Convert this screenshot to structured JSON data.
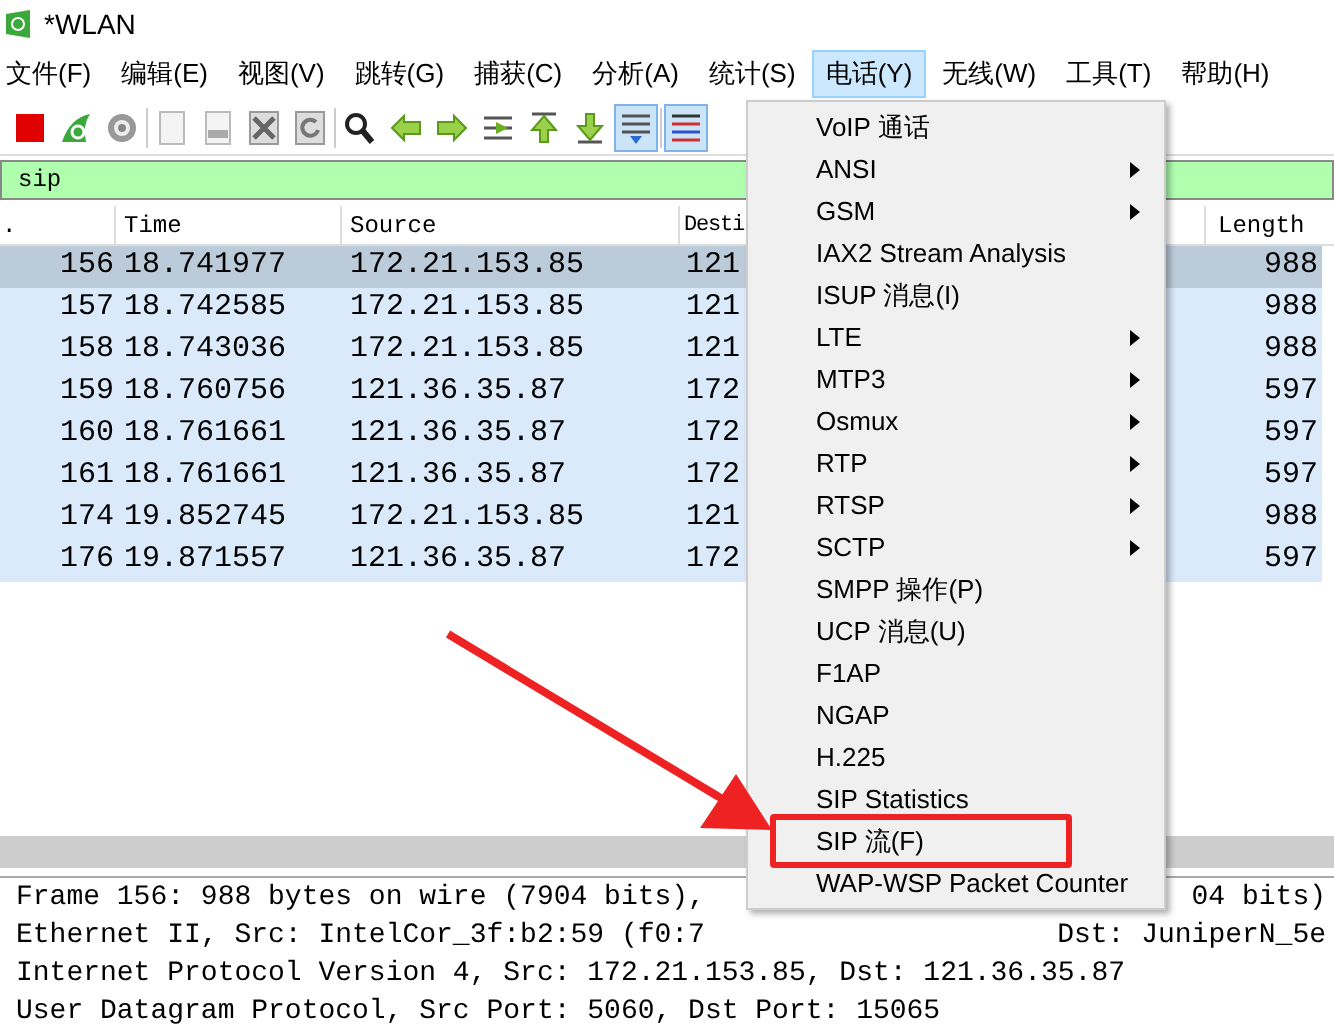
{
  "window": {
    "title": "*WLAN"
  },
  "menubar": [
    {
      "label": "文件(F)",
      "selected": false
    },
    {
      "label": "编辑(E)",
      "selected": false
    },
    {
      "label": "视图(V)",
      "selected": false
    },
    {
      "label": "跳转(G)",
      "selected": false
    },
    {
      "label": "捕获(C)",
      "selected": false
    },
    {
      "label": "分析(A)",
      "selected": false
    },
    {
      "label": "统计(S)",
      "selected": false
    },
    {
      "label": "电话(Y)",
      "selected": true
    },
    {
      "label": "无线(W)",
      "selected": false
    },
    {
      "label": "工具(T)",
      "selected": false
    },
    {
      "label": "帮助(H)",
      "selected": false
    }
  ],
  "toolbar": [
    {
      "kind": "stop",
      "selected": false
    },
    {
      "kind": "restart",
      "selected": false
    },
    {
      "kind": "options",
      "selected": false
    },
    {
      "kind": "sep"
    },
    {
      "kind": "open",
      "selected": false
    },
    {
      "kind": "save",
      "selected": false
    },
    {
      "kind": "close",
      "selected": false
    },
    {
      "kind": "reload",
      "selected": false
    },
    {
      "kind": "sep"
    },
    {
      "kind": "find",
      "selected": false
    },
    {
      "kind": "back",
      "selected": false
    },
    {
      "kind": "forward",
      "selected": false
    },
    {
      "kind": "goto",
      "selected": false
    },
    {
      "kind": "first",
      "selected": false
    },
    {
      "kind": "last",
      "selected": false
    },
    {
      "kind": "autoscroll",
      "selected": true
    },
    {
      "kind": "sep"
    },
    {
      "kind": "colorize",
      "selected": true
    }
  ],
  "filter": {
    "value": "sip"
  },
  "packet_list": {
    "columns": [
      ".",
      "Time",
      "Source",
      "Desti",
      "Length"
    ],
    "rows": [
      {
        "no": "156",
        "time": "18.741977",
        "source": "172.21.153.85",
        "destination": "121",
        "length": "988",
        "selected": true
      },
      {
        "no": "157",
        "time": "18.742585",
        "source": "172.21.153.85",
        "destination": "121",
        "length": "988",
        "selected": false
      },
      {
        "no": "158",
        "time": "18.743036",
        "source": "172.21.153.85",
        "destination": "121",
        "length": "988",
        "selected": false
      },
      {
        "no": "159",
        "time": "18.760756",
        "source": "121.36.35.87",
        "destination": "172",
        "length": "597",
        "selected": false
      },
      {
        "no": "160",
        "time": "18.761661",
        "source": "121.36.35.87",
        "destination": "172",
        "length": "597",
        "selected": false
      },
      {
        "no": "161",
        "time": "18.761661",
        "source": "121.36.35.87",
        "destination": "172",
        "length": "597",
        "selected": false
      },
      {
        "no": "174",
        "time": "19.852745",
        "source": "172.21.153.85",
        "destination": "121",
        "length": "988",
        "selected": false
      },
      {
        "no": "176",
        "time": "19.871557",
        "source": "121.36.35.87",
        "destination": "172",
        "length": "597",
        "selected": false
      }
    ]
  },
  "details": [
    {
      "left": "Frame 156: 988 bytes on wire (7904 bits),",
      "right": "04 bits)"
    },
    {
      "left": "Ethernet II, Src: IntelCor_3f:b2:59 (f0:7",
      "right": "Dst: JuniperN_5e"
    },
    {
      "left": "Internet Protocol Version 4, Src: 172.21.153.85, Dst: 121.36.35.87"
    },
    {
      "left": "User Datagram Protocol, Src Port: 5060, Dst Port: 15065"
    }
  ],
  "telephony_menu": [
    {
      "label": "VoIP 通话",
      "submenu": false
    },
    {
      "label": "ANSI",
      "submenu": true
    },
    {
      "label": "GSM",
      "submenu": true
    },
    {
      "label": "IAX2 Stream Analysis",
      "submenu": false
    },
    {
      "label": "ISUP 消息(I)",
      "submenu": false
    },
    {
      "label": "LTE",
      "submenu": true
    },
    {
      "label": "MTP3",
      "submenu": true
    },
    {
      "label": "Osmux",
      "submenu": true
    },
    {
      "label": "RTP",
      "submenu": true
    },
    {
      "label": "RTSP",
      "submenu": true
    },
    {
      "label": "SCTP",
      "submenu": true
    },
    {
      "label": "SMPP 操作(P)",
      "submenu": false
    },
    {
      "label": "UCP 消息(U)",
      "submenu": false
    },
    {
      "label": "F1AP",
      "submenu": false
    },
    {
      "label": "NGAP",
      "submenu": false
    },
    {
      "label": "H.225",
      "submenu": false
    },
    {
      "label": "SIP Statistics",
      "submenu": false
    },
    {
      "label": "SIP 流(F)",
      "submenu": false
    },
    {
      "label": "WAP-WSP Packet Counter",
      "submenu": false
    }
  ]
}
